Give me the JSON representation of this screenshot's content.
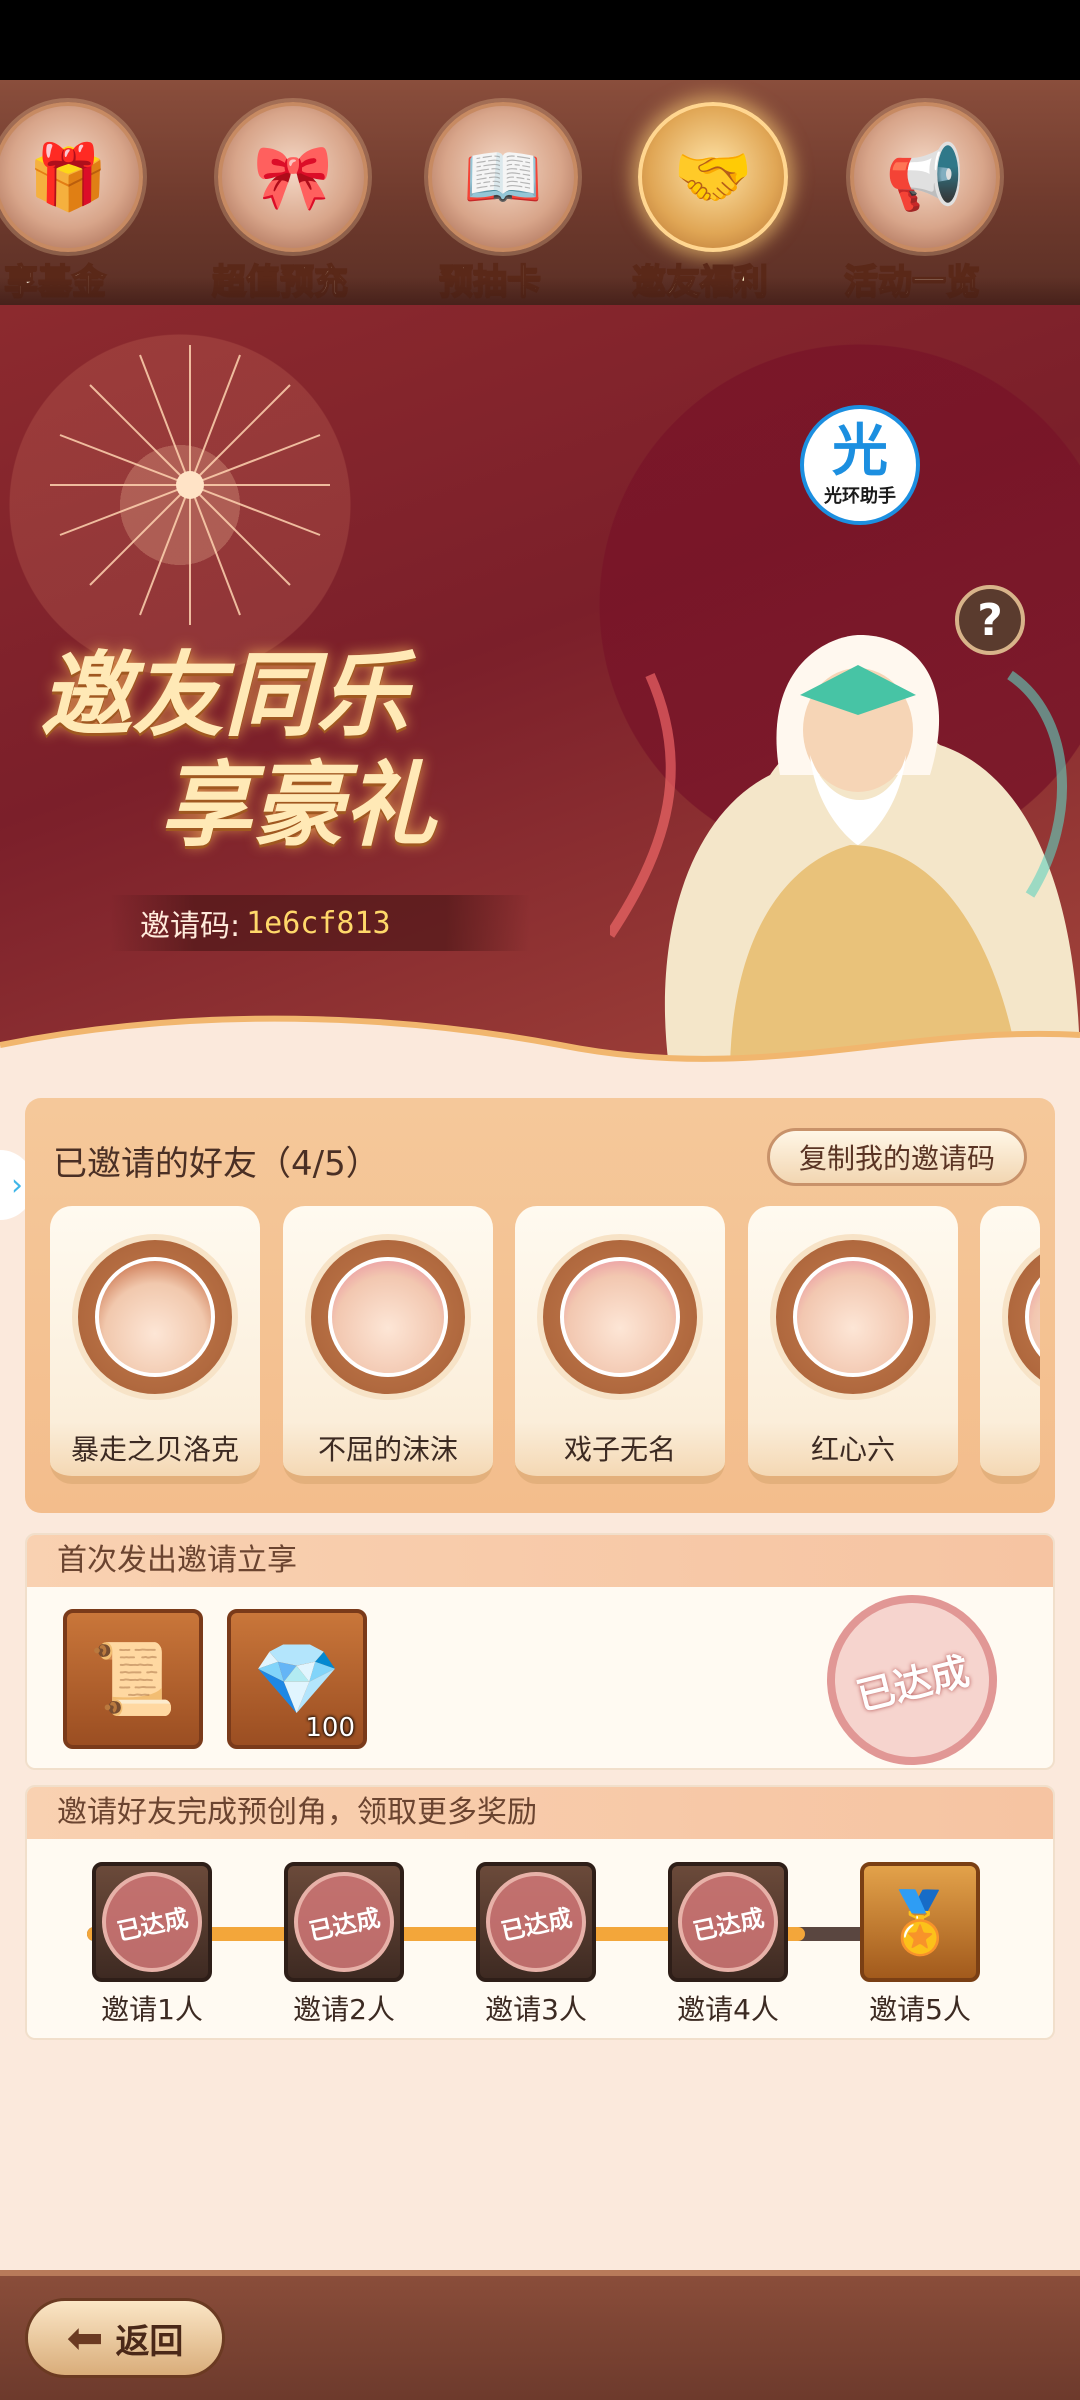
{
  "tabs": [
    {
      "label": "享基金",
      "icon": "gift-box-icon",
      "active": false
    },
    {
      "label": "超值预充",
      "icon": "ribbon-gift-icon",
      "active": false
    },
    {
      "label": "预抽卡",
      "icon": "card-book-icon",
      "active": false
    },
    {
      "label": "邀友福利",
      "icon": "handshake-icon",
      "active": true
    },
    {
      "label": "活动一览",
      "icon": "megaphone-icon",
      "active": false
    }
  ],
  "banner": {
    "title_line1": "邀友同乐",
    "title_line2": "享豪礼",
    "invite_code_label": "邀请码:",
    "invite_code_value": "1e6cf813",
    "helper_badge_glyph": "光",
    "helper_badge_text": "光环助手",
    "help_label": "?"
  },
  "friends": {
    "title": "已邀请的好友（4/5）",
    "copy_button": "复制我的邀请码",
    "list": [
      {
        "name": "暴走之贝洛克"
      },
      {
        "name": "不屈的沫沫"
      },
      {
        "name": "戏子无名"
      },
      {
        "name": "红心六"
      }
    ]
  },
  "first_invite": {
    "title": "首次发出邀请立享",
    "rewards": [
      {
        "icon": "scroll-icon",
        "qty": ""
      },
      {
        "icon": "diamond-icon",
        "qty": "100"
      }
    ],
    "status": "已达成"
  },
  "progress": {
    "title": "邀请好友完成预创角，领取更多奖励",
    "milestones": [
      {
        "label": "邀请1人",
        "achieved": true,
        "stamp": "已达成"
      },
      {
        "label": "邀请2人",
        "achieved": true,
        "stamp": "已达成"
      },
      {
        "label": "邀请3人",
        "achieved": true,
        "stamp": "已达成"
      },
      {
        "label": "邀请4人",
        "achieved": true,
        "stamp": "已达成"
      },
      {
        "label": "邀请5人",
        "achieved": false,
        "stamp": ""
      }
    ],
    "completed": 4,
    "total": 5
  },
  "footer": {
    "back_label": "返回"
  },
  "colors": {
    "accent": "#f3a63a",
    "panel": "#f5c89a",
    "banner": "#7b1f2a"
  }
}
